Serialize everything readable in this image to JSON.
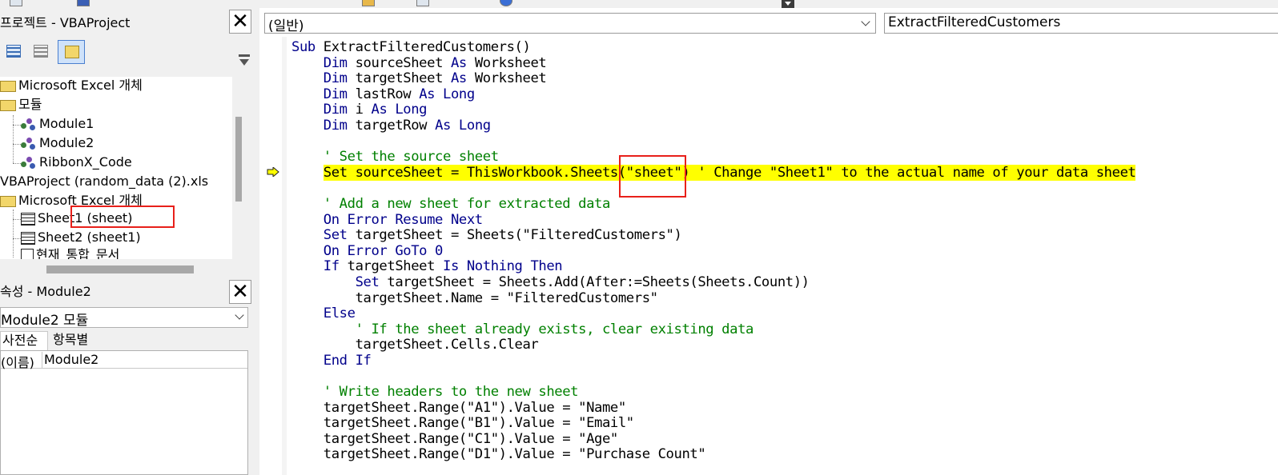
{
  "project_pane": {
    "title": "프로젝트 - VBAProject",
    "tree": [
      {
        "label": "Microsoft Excel 개체",
        "type": "folder"
      },
      {
        "label": "모듈",
        "type": "folder"
      },
      {
        "label": "Module1",
        "type": "module"
      },
      {
        "label": "Module2",
        "type": "module"
      },
      {
        "label": "RibbonX_Code",
        "type": "module"
      },
      {
        "label": "VBAProject (random_data (2).xls",
        "type": "project"
      },
      {
        "label": "Microsoft Excel 개체",
        "type": "folder"
      },
      {
        "label": "Sheet1 (sheet)",
        "type": "sheet"
      },
      {
        "label": "Sheet2 (sheet1)",
        "type": "sheet"
      },
      {
        "label": "현재_통합_문서",
        "type": "workbook"
      }
    ]
  },
  "properties_pane": {
    "title": "속성 - Module2",
    "object_select": "Module2 모듈",
    "tabs": [
      "사전순",
      "항목별"
    ],
    "rows": [
      {
        "key": "(이름)",
        "value": "Module2"
      }
    ]
  },
  "code_window": {
    "object_dropdown": "(일반)",
    "procedure_dropdown": "ExtractFilteredCustomers",
    "lines": [
      [
        {
          "t": "Sub ",
          "c": "kw"
        },
        {
          "t": "ExtractFilteredCustomers()",
          "c": ""
        }
      ],
      [
        {
          "t": "    Dim ",
          "c": "kw"
        },
        {
          "t": "sourceSheet ",
          "c": ""
        },
        {
          "t": "As ",
          "c": "kw"
        },
        {
          "t": "Worksheet",
          "c": ""
        }
      ],
      [
        {
          "t": "    Dim ",
          "c": "kw"
        },
        {
          "t": "targetSheet ",
          "c": ""
        },
        {
          "t": "As ",
          "c": "kw"
        },
        {
          "t": "Worksheet",
          "c": ""
        }
      ],
      [
        {
          "t": "    Dim ",
          "c": "kw"
        },
        {
          "t": "lastRow ",
          "c": ""
        },
        {
          "t": "As Long",
          "c": "kw"
        }
      ],
      [
        {
          "t": "    Dim ",
          "c": "kw"
        },
        {
          "t": "i ",
          "c": ""
        },
        {
          "t": "As Long",
          "c": "kw"
        }
      ],
      [
        {
          "t": "    Dim ",
          "c": "kw"
        },
        {
          "t": "targetRow ",
          "c": ""
        },
        {
          "t": "As Long",
          "c": "kw"
        }
      ],
      [],
      [
        {
          "t": "    ' Set the source sheet",
          "c": "cm"
        }
      ],
      [
        {
          "t": "    ",
          "c": ""
        },
        {
          "t": "Set sourceSheet = ThisWorkbook.Sheets(\"sheet\") ' Change \"Sheet1\" to the actual name of your data sheet",
          "c": "hl"
        }
      ],
      [],
      [
        {
          "t": "    ' Add a new sheet for extracted data",
          "c": "cm"
        }
      ],
      [
        {
          "t": "    On Error Resume Next",
          "c": "kw"
        }
      ],
      [
        {
          "t": "    Set ",
          "c": "kw"
        },
        {
          "t": "targetSheet = Sheets(\"FilteredCustomers\")",
          "c": ""
        }
      ],
      [
        {
          "t": "    On Error GoTo 0",
          "c": "kw"
        }
      ],
      [
        {
          "t": "    If ",
          "c": "kw"
        },
        {
          "t": "targetSheet ",
          "c": ""
        },
        {
          "t": "Is Nothing Then",
          "c": "kw"
        }
      ],
      [
        {
          "t": "        Set ",
          "c": "kw"
        },
        {
          "t": "targetSheet = Sheets.Add(After:=Sheets(Sheets.Count))",
          "c": ""
        }
      ],
      [
        {
          "t": "        targetSheet.Name = \"FilteredCustomers\"",
          "c": ""
        }
      ],
      [
        {
          "t": "    Else",
          "c": "kw"
        }
      ],
      [
        {
          "t": "        ' If the sheet already exists, clear existing data",
          "c": "cm"
        }
      ],
      [
        {
          "t": "        targetSheet.Cells.Clear",
          "c": ""
        }
      ],
      [
        {
          "t": "    End If",
          "c": "kw"
        }
      ],
      [],
      [
        {
          "t": "    ' Write headers to the new sheet",
          "c": "cm"
        }
      ],
      [
        {
          "t": "    targetSheet.Range(\"A1\").Value = \"Name\"",
          "c": ""
        }
      ],
      [
        {
          "t": "    targetSheet.Range(\"B1\").Value = \"Email\"",
          "c": ""
        }
      ],
      [
        {
          "t": "    targetSheet.Range(\"C1\").Value = \"Age\"",
          "c": ""
        }
      ],
      [
        {
          "t": "    targetSheet.Range(\"D1\").Value = \"Purchase Count\"",
          "c": ""
        }
      ]
    ]
  },
  "colors": {
    "keyword": "#00008b",
    "comment": "#008000",
    "highlight": "#ffff00",
    "annotation_box": "#e8201a"
  },
  "icons": {
    "execution_arrow": "yellow-arrow-icon",
    "close": "close-icon",
    "dropdown": "chevron-down-icon"
  }
}
